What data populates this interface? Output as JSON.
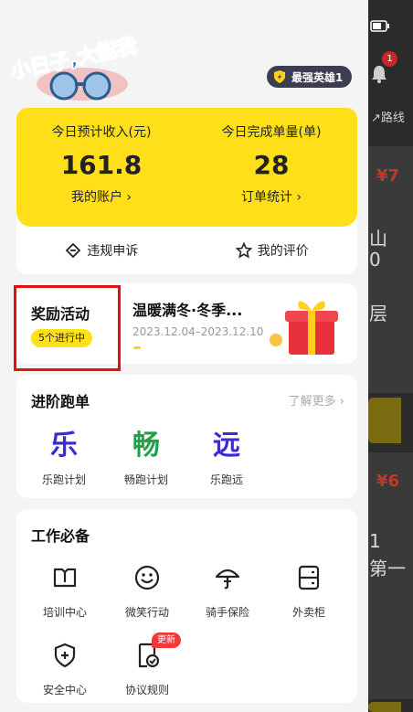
{
  "background": {
    "right_texts": [
      "山",
      "0",
      "层",
      "1",
      "第一"
    ],
    "prices": [
      "¥7",
      "¥6"
    ],
    "route_label": "路线"
  },
  "logo": {
    "text": "小日子,大能我"
  },
  "hero_badge": {
    "label": "最强英雄1"
  },
  "income": {
    "left": {
      "label": "今日预计收入(元)",
      "value": "161.8",
      "link": "我的账户 ›"
    },
    "right": {
      "label": "今日完成单量(单)",
      "value": "28",
      "link": "订单统计 ›"
    }
  },
  "actions": [
    {
      "label": "违规申诉",
      "icon": "appeal-icon"
    },
    {
      "label": "我的评价",
      "icon": "star-icon"
    }
  ],
  "reward": {
    "title": "奖励活动",
    "pill": "5个进行中",
    "promo_title": "温暖满冬·冬季...",
    "promo_date": "2023.12.04–2023.12.10"
  },
  "run": {
    "title": "进阶跑单",
    "more": "了解更多 ›",
    "items": [
      {
        "glyph": "乐",
        "label": "乐跑计划",
        "color": "#3a2bd6"
      },
      {
        "glyph": "畅",
        "label": "畅跑计划",
        "color": "#22a04a"
      },
      {
        "glyph": "远",
        "label": "乐跑远",
        "color": "#3a2bd6"
      }
    ]
  },
  "tools": {
    "title": "工作必备",
    "items": [
      {
        "label": "培训中心",
        "icon": "book-icon"
      },
      {
        "label": "微笑行动",
        "icon": "smile-icon"
      },
      {
        "label": "骑手保险",
        "icon": "umbrella-icon"
      },
      {
        "label": "外卖柜",
        "icon": "locker-icon"
      },
      {
        "label": "安全中心",
        "icon": "shield-icon"
      },
      {
        "label": "协议规则",
        "icon": "document-check-icon",
        "badge": "更新"
      }
    ]
  },
  "colors": {
    "accent_yellow": "#ffde1a",
    "highlight_red": "#e31212",
    "badge_red": "#f4383a"
  }
}
